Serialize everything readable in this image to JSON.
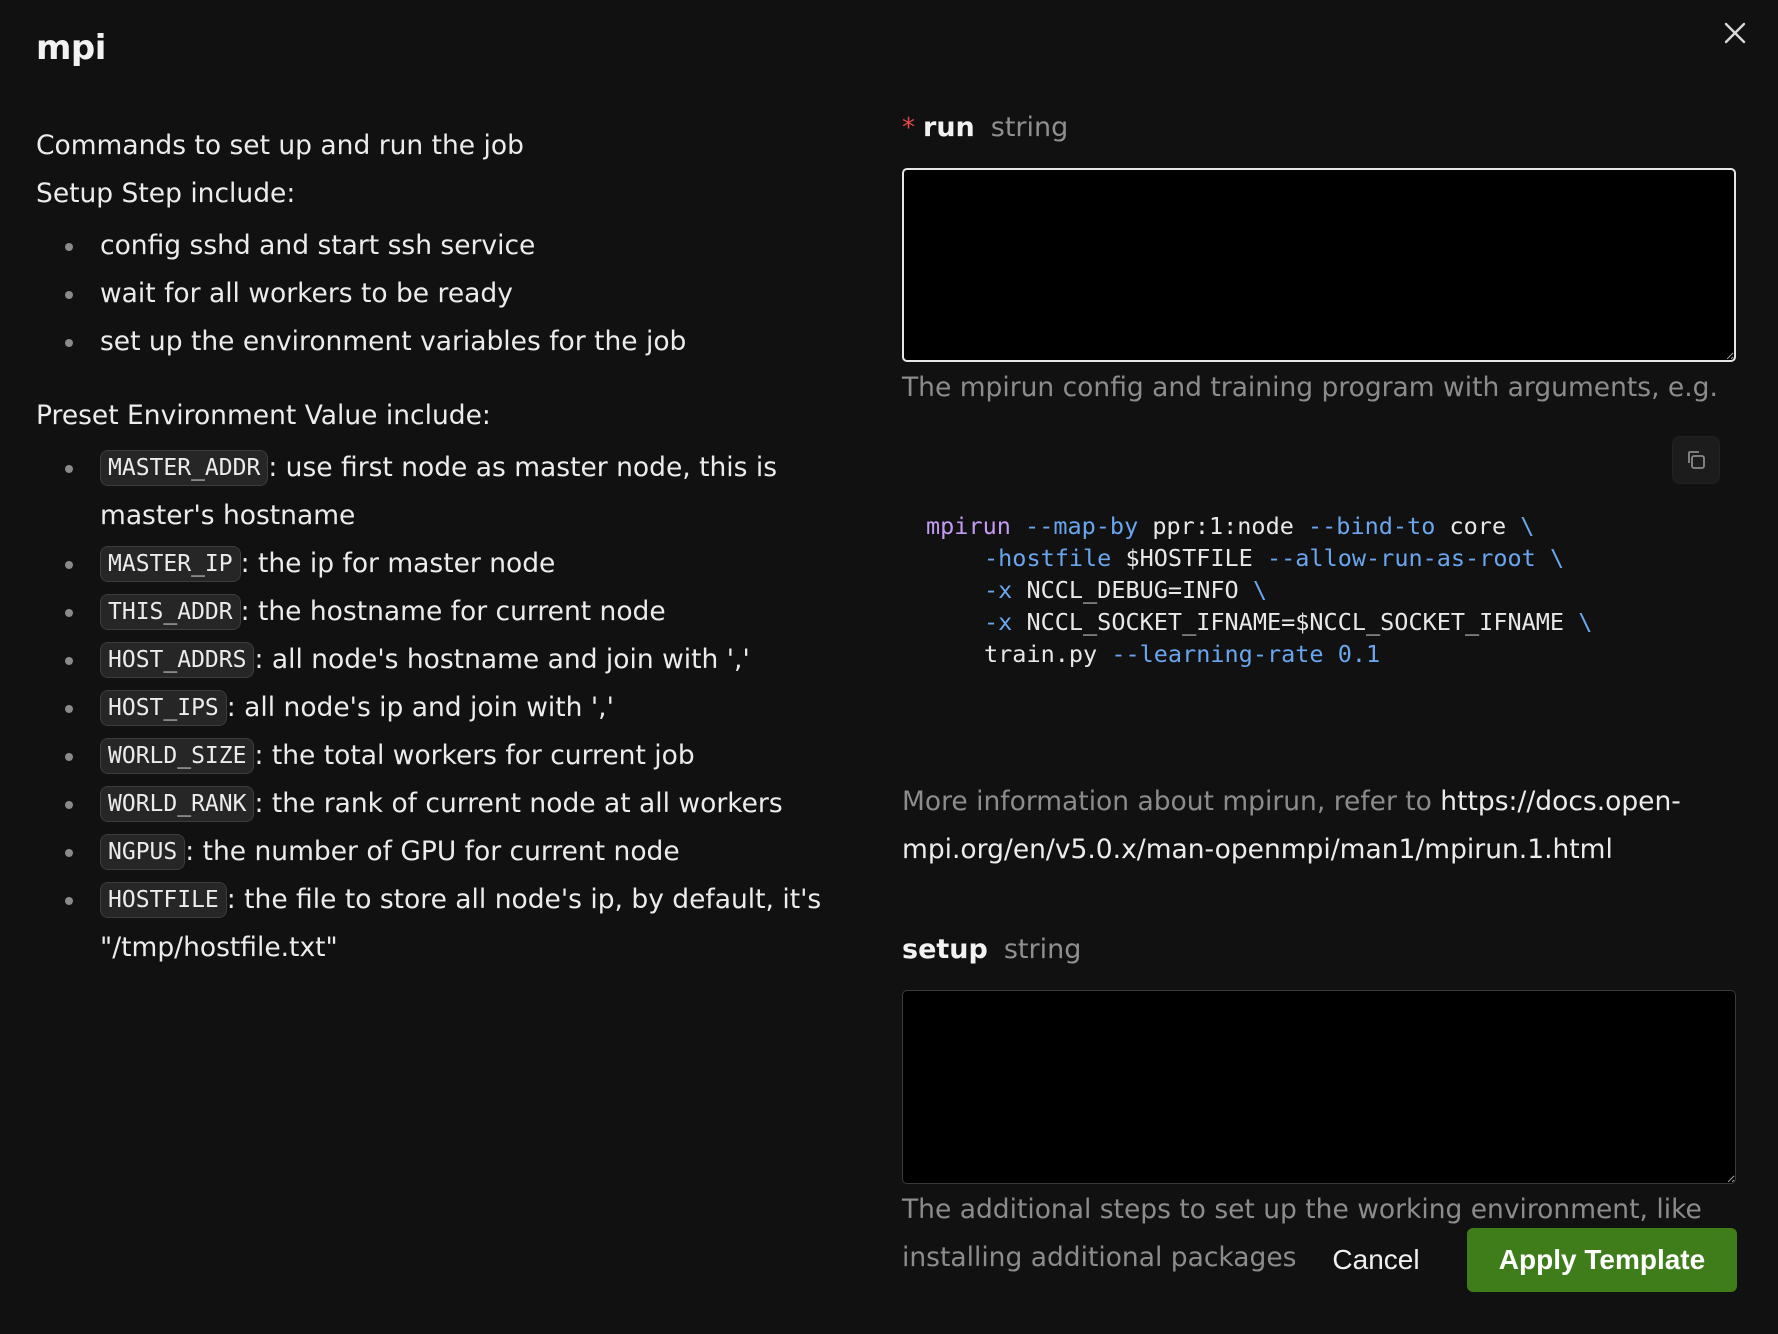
{
  "dialog": {
    "title": "mpi",
    "close_icon": "close-icon"
  },
  "description": {
    "intro": "Commands to set up and run the job",
    "setup_heading": "Setup Step include:",
    "setup_steps": [
      "config sshd and start ssh service",
      "wait for all workers to be ready",
      "set up the environment variables for the job"
    ],
    "env_heading": "Preset Environment Value include:",
    "env_vars": [
      {
        "name": "MASTER_ADDR",
        "desc": ": use first node as master node, this is master's hostname"
      },
      {
        "name": "MASTER_IP",
        "desc": ": the ip for master node"
      },
      {
        "name": "THIS_ADDR",
        "desc": ": the hostname for current node"
      },
      {
        "name": "HOST_ADDRS",
        "desc": ": all node's hostname and join with ','"
      },
      {
        "name": "HOST_IPS",
        "desc": ": all node's ip and join with ','"
      },
      {
        "name": "WORLD_SIZE",
        "desc": ": the total workers for current job"
      },
      {
        "name": "WORLD_RANK",
        "desc": ": the rank of current node at all workers"
      },
      {
        "name": "NGPUS",
        "desc": ": the number of GPU for current node"
      },
      {
        "name": "HOSTFILE",
        "desc": ": the file to store all node's ip, by default, it's \"/tmp/hostfile.txt\""
      }
    ]
  },
  "run_field": {
    "required_marker": "*",
    "label": "run",
    "type": "string",
    "value": "",
    "help": "The mpirun config and training program with arguments, e.g.",
    "more_info_prefix": "More information about mpirun, refer to ",
    "more_info_link": "https://docs.open-mpi.org/en/v5.0.x/man-openmpi/man1/mpirun.1.html",
    "copy_icon": "copy-icon"
  },
  "code_example": {
    "lines": [
      [
        {
          "t": "mpirun",
          "k": "cmd"
        },
        {
          "t": " ",
          "k": "plain"
        },
        {
          "t": "--map-by",
          "k": "flag"
        },
        {
          "t": " ppr:1:node ",
          "k": "plain"
        },
        {
          "t": "--bind-to",
          "k": "flag"
        },
        {
          "t": " core ",
          "k": "plain"
        },
        {
          "t": "\\",
          "k": "flag"
        }
      ],
      [
        {
          "t": "-hostfile",
          "k": "flag"
        },
        {
          "t": " $HOSTFILE ",
          "k": "plain"
        },
        {
          "t": "--allow-run-as-root",
          "k": "flag"
        },
        {
          "t": " ",
          "k": "plain"
        },
        {
          "t": "\\",
          "k": "flag"
        }
      ],
      [
        {
          "t": "-x",
          "k": "flag"
        },
        {
          "t": " NCCL_DEBUG=INFO ",
          "k": "plain"
        },
        {
          "t": "\\",
          "k": "flag"
        }
      ],
      [
        {
          "t": "-x",
          "k": "flag"
        },
        {
          "t": " NCCL_SOCKET_IFNAME=$NCCL_SOCKET_IFNAME ",
          "k": "plain"
        },
        {
          "t": "\\",
          "k": "flag"
        }
      ],
      [
        {
          "t": "train.py ",
          "k": "plain"
        },
        {
          "t": "--learning-rate",
          "k": "flag"
        },
        {
          "t": " ",
          "k": "plain"
        },
        {
          "t": "0.1",
          "k": "num"
        }
      ]
    ]
  },
  "setup_field": {
    "label": "setup",
    "type": "string",
    "value": "",
    "help": "The additional steps to set up the working environment, like installing additional packages"
  },
  "footer": {
    "cancel_label": "Cancel",
    "apply_label": "Apply Template"
  },
  "colors": {
    "background": "#111111",
    "accent": "#3e7d1a",
    "required": "#e5484d",
    "code_command": "#c39bf2",
    "code_flag": "#6aa6ef"
  }
}
